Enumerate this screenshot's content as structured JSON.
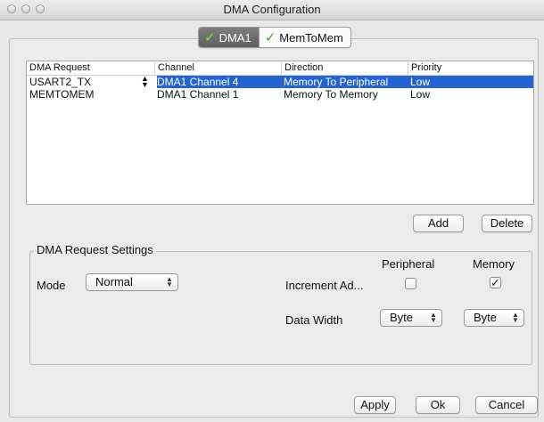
{
  "window": {
    "title": "DMA Configuration"
  },
  "tabs": [
    {
      "label": "DMA1",
      "active": true,
      "icon": "check-icon"
    },
    {
      "label": "MemToMem",
      "active": false,
      "icon": "check-icon"
    }
  ],
  "table": {
    "columns": [
      "DMA Request",
      "Channel",
      "Direction",
      "Priority"
    ],
    "rows": [
      {
        "request": "USART2_TX",
        "channel": "DMA1 Channel 4",
        "direction": "Memory To Peripheral",
        "priority": "Low",
        "selected": true
      },
      {
        "request": "MEMTOMEM",
        "channel": "DMA1 Channel 1",
        "direction": "Memory To Memory",
        "priority": "Low",
        "selected": false
      }
    ]
  },
  "actions": {
    "add": "Add",
    "delete": "Delete"
  },
  "settings": {
    "group_title": "DMA Request Settings",
    "mode_label": "Mode",
    "mode_value": "Normal",
    "peripheral_header": "Peripheral",
    "memory_header": "Memory",
    "increment_label": "Increment Ad...",
    "increment_peripheral": false,
    "increment_memory": true,
    "data_width_label": "Data Width",
    "data_width_peripheral": "Byte",
    "data_width_memory": "Byte"
  },
  "footer": {
    "apply": "Apply",
    "ok": "Ok",
    "cancel": "Cancel"
  },
  "colors": {
    "selection": "#2563d2",
    "check_green": "#3faa1e"
  }
}
